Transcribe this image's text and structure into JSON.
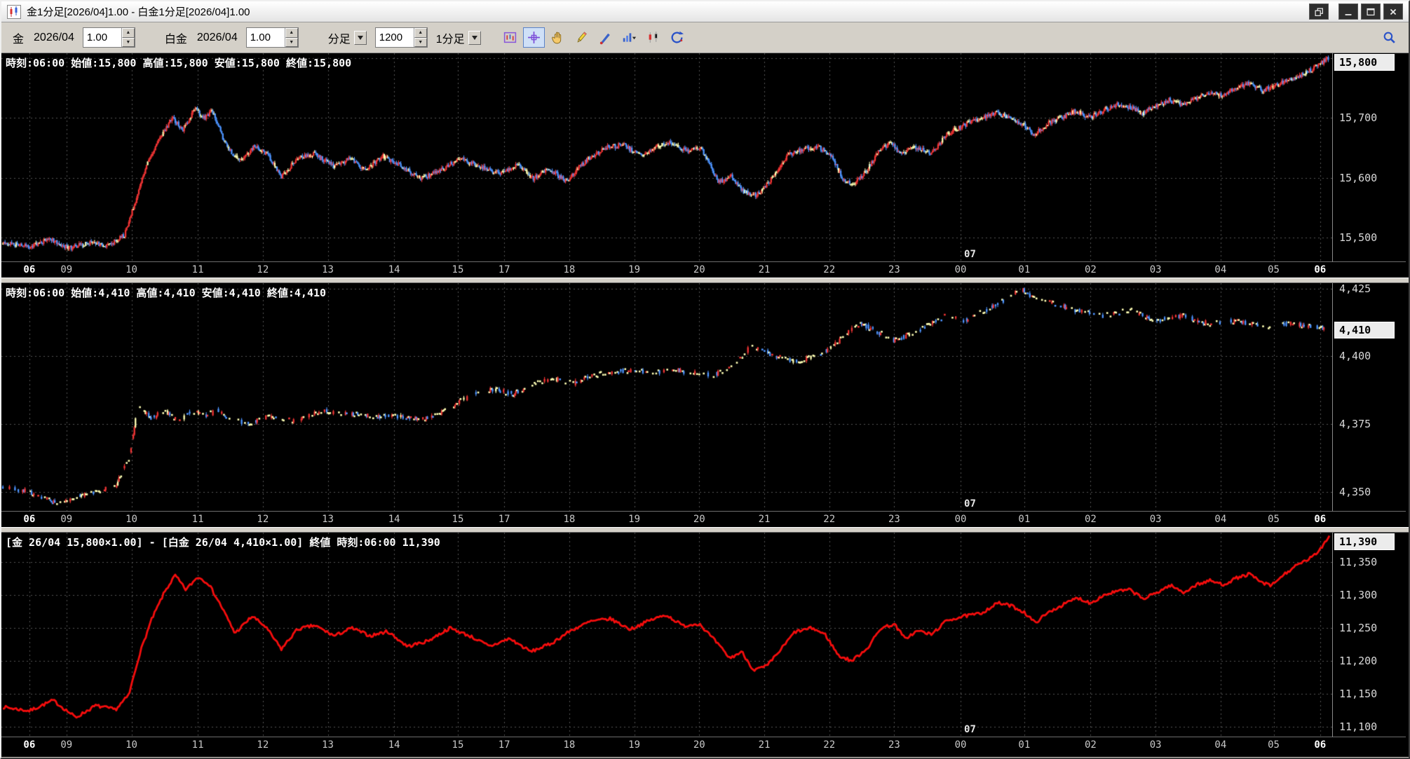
{
  "window": {
    "title": "金1分足[2026/04]1.00 - 白金1分足[2026/04]1.00"
  },
  "toolbar": {
    "gold_label": "金",
    "gold_month": "2026/04",
    "gold_ratio": "1.00",
    "platinum_label": "白金",
    "platinum_month": "2026/04",
    "platinum_ratio": "1.00",
    "period_label": "分足",
    "bar_count": "1200",
    "style_label": "1分足"
  },
  "colors": {
    "grid": "#565656",
    "up": "#f23535",
    "down": "#4d94ff",
    "doji": "#ffffb4",
    "spread_line": "#f50d0d",
    "axis_text": "#d0d0d0"
  },
  "xaxis": {
    "ticks": [
      {
        "frac": 0.02,
        "label": "06",
        "bold": true
      },
      {
        "frac": 0.048,
        "label": "09"
      },
      {
        "frac": 0.097,
        "label": "10"
      },
      {
        "frac": 0.147,
        "label": "11"
      },
      {
        "frac": 0.196,
        "label": "12"
      },
      {
        "frac": 0.245,
        "label": "13"
      },
      {
        "frac": 0.295,
        "label": "14"
      },
      {
        "frac": 0.343,
        "label": "15"
      },
      {
        "frac": 0.378,
        "label": "17"
      },
      {
        "frac": 0.427,
        "label": "18"
      },
      {
        "frac": 0.476,
        "label": "19"
      },
      {
        "frac": 0.525,
        "label": "20"
      },
      {
        "frac": 0.574,
        "label": "21"
      },
      {
        "frac": 0.623,
        "label": "22"
      },
      {
        "frac": 0.672,
        "label": "23"
      },
      {
        "frac": 0.722,
        "label": "00"
      },
      {
        "frac": 0.77,
        "label": "01"
      },
      {
        "frac": 0.82,
        "label": "02"
      },
      {
        "frac": 0.869,
        "label": "03"
      },
      {
        "frac": 0.918,
        "label": "04"
      },
      {
        "frac": 0.958,
        "label": "05"
      },
      {
        "frac": 0.993,
        "label": "06",
        "bold": true
      }
    ]
  },
  "chart_data": [
    {
      "type": "candlestick",
      "name": "gold-1min",
      "info": "時刻:06:00 始値:15,800 高値:15,800 安値:15,800 終値:15,800",
      "ylim": [
        15460,
        15808
      ],
      "yticks": [
        {
          "v": 15800,
          "label": "15,800"
        },
        {
          "v": 15700,
          "label": "15,700"
        },
        {
          "v": 15600,
          "label": "15,600"
        },
        {
          "v": 15500,
          "label": "15,500"
        }
      ],
      "last": {
        "v": 15800,
        "label": "15,800"
      },
      "date_label": "07",
      "date_frac": 0.722,
      "seed": 11,
      "candles": 1200,
      "noise": 4,
      "range": 4,
      "doji": 1.0,
      "density": 1,
      "anchors": [
        [
          0,
          15490
        ],
        [
          0.02,
          15485
        ],
        [
          0.035,
          15498
        ],
        [
          0.05,
          15482
        ],
        [
          0.065,
          15492
        ],
        [
          0.08,
          15486
        ],
        [
          0.092,
          15505
        ],
        [
          0.1,
          15560
        ],
        [
          0.108,
          15620
        ],
        [
          0.118,
          15665
        ],
        [
          0.128,
          15700
        ],
        [
          0.136,
          15680
        ],
        [
          0.145,
          15715
        ],
        [
          0.152,
          15700
        ],
        [
          0.158,
          15712
        ],
        [
          0.168,
          15655
        ],
        [
          0.178,
          15628
        ],
        [
          0.19,
          15652
        ],
        [
          0.2,
          15638
        ],
        [
          0.21,
          15600
        ],
        [
          0.222,
          15632
        ],
        [
          0.235,
          15640
        ],
        [
          0.25,
          15618
        ],
        [
          0.262,
          15632
        ],
        [
          0.274,
          15612
        ],
        [
          0.287,
          15636
        ],
        [
          0.3,
          15620
        ],
        [
          0.315,
          15598
        ],
        [
          0.33,
          15612
        ],
        [
          0.345,
          15632
        ],
        [
          0.36,
          15618
        ],
        [
          0.375,
          15608
        ],
        [
          0.39,
          15622
        ],
        [
          0.4,
          15598
        ],
        [
          0.412,
          15615
        ],
        [
          0.425,
          15594
        ],
        [
          0.44,
          15628
        ],
        [
          0.455,
          15650
        ],
        [
          0.468,
          15655
        ],
        [
          0.48,
          15638
        ],
        [
          0.492,
          15650
        ],
        [
          0.503,
          15660
        ],
        [
          0.515,
          15645
        ],
        [
          0.527,
          15648
        ],
        [
          0.54,
          15592
        ],
        [
          0.55,
          15602
        ],
        [
          0.558,
          15578
        ],
        [
          0.568,
          15570
        ],
        [
          0.58,
          15598
        ],
        [
          0.592,
          15638
        ],
        [
          0.605,
          15648
        ],
        [
          0.615,
          15652
        ],
        [
          0.625,
          15638
        ],
        [
          0.633,
          15600
        ],
        [
          0.642,
          15588
        ],
        [
          0.652,
          15612
        ],
        [
          0.662,
          15648
        ],
        [
          0.67,
          15658
        ],
        [
          0.678,
          15638
        ],
        [
          0.688,
          15652
        ],
        [
          0.7,
          15640
        ],
        [
          0.712,
          15672
        ],
        [
          0.725,
          15688
        ],
        [
          0.737,
          15698
        ],
        [
          0.75,
          15710
        ],
        [
          0.76,
          15698
        ],
        [
          0.77,
          15688
        ],
        [
          0.778,
          15672
        ],
        [
          0.79,
          15692
        ],
        [
          0.8,
          15702
        ],
        [
          0.81,
          15712
        ],
        [
          0.82,
          15700
        ],
        [
          0.83,
          15712
        ],
        [
          0.84,
          15722
        ],
        [
          0.85,
          15718
        ],
        [
          0.86,
          15708
        ],
        [
          0.87,
          15720
        ],
        [
          0.88,
          15730
        ],
        [
          0.89,
          15722
        ],
        [
          0.9,
          15732
        ],
        [
          0.91,
          15742
        ],
        [
          0.92,
          15738
        ],
        [
          0.93,
          15750
        ],
        [
          0.94,
          15758
        ],
        [
          0.95,
          15746
        ],
        [
          0.958,
          15752
        ],
        [
          0.967,
          15760
        ],
        [
          0.976,
          15768
        ],
        [
          0.985,
          15778
        ],
        [
          0.993,
          15788
        ],
        [
          1,
          15800
        ]
      ]
    },
    {
      "type": "candlestick",
      "name": "platinum-1min",
      "info": "時刻:06:00 始値:4,410 高値:4,410 安値:4,410 終値:4,410",
      "ylim": [
        4343,
        4427
      ],
      "yticks": [
        {
          "v": 4425,
          "label": "4,425"
        },
        {
          "v": 4400,
          "label": "4,400"
        },
        {
          "v": 4375,
          "label": "4,375"
        },
        {
          "v": 4350,
          "label": "4,350"
        }
      ],
      "last": {
        "v": 4410,
        "label": "4,410"
      },
      "date_label": "07",
      "date_frac": 0.722,
      "seed": 23,
      "candles": 1200,
      "noise": 0.9,
      "range": 0.8,
      "doji": 0.5,
      "density": 0.45,
      "anchors": [
        [
          0,
          4352
        ],
        [
          0.02,
          4350
        ],
        [
          0.04,
          4346
        ],
        [
          0.055,
          4348
        ],
        [
          0.07,
          4350
        ],
        [
          0.085,
          4352
        ],
        [
          0.095,
          4362
        ],
        [
          0.102,
          4382
        ],
        [
          0.112,
          4377
        ],
        [
          0.122,
          4380
        ],
        [
          0.132,
          4376
        ],
        [
          0.142,
          4380
        ],
        [
          0.152,
          4378
        ],
        [
          0.162,
          4380
        ],
        [
          0.172,
          4377
        ],
        [
          0.185,
          4375
        ],
        [
          0.2,
          4378
        ],
        [
          0.22,
          4376
        ],
        [
          0.24,
          4380
        ],
        [
          0.26,
          4379
        ],
        [
          0.28,
          4378
        ],
        [
          0.3,
          4378
        ],
        [
          0.32,
          4377
        ],
        [
          0.34,
          4382
        ],
        [
          0.355,
          4386
        ],
        [
          0.37,
          4388
        ],
        [
          0.385,
          4386
        ],
        [
          0.4,
          4390
        ],
        [
          0.415,
          4392
        ],
        [
          0.43,
          4390
        ],
        [
          0.445,
          4393
        ],
        [
          0.46,
          4394
        ],
        [
          0.475,
          4395
        ],
        [
          0.49,
          4394
        ],
        [
          0.505,
          4395
        ],
        [
          0.52,
          4394
        ],
        [
          0.535,
          4393
        ],
        [
          0.55,
          4396
        ],
        [
          0.565,
          4404
        ],
        [
          0.578,
          4401
        ],
        [
          0.59,
          4399
        ],
        [
          0.6,
          4398
        ],
        [
          0.612,
          4400
        ],
        [
          0.625,
          4403
        ],
        [
          0.638,
          4409
        ],
        [
          0.648,
          4412
        ],
        [
          0.66,
          4409
        ],
        [
          0.672,
          4406
        ],
        [
          0.685,
          4408
        ],
        [
          0.7,
          4412
        ],
        [
          0.712,
          4415
        ],
        [
          0.725,
          4413
        ],
        [
          0.737,
          4416
        ],
        [
          0.75,
          4419
        ],
        [
          0.762,
          4423
        ],
        [
          0.768,
          4425
        ],
        [
          0.775,
          4422
        ],
        [
          0.79,
          4420
        ],
        [
          0.81,
          4417
        ],
        [
          0.83,
          4415
        ],
        [
          0.85,
          4417
        ],
        [
          0.87,
          4413
        ],
        [
          0.89,
          4415
        ],
        [
          0.91,
          4412
        ],
        [
          0.93,
          4413
        ],
        [
          0.95,
          4411
        ],
        [
          0.97,
          4412
        ],
        [
          0.985,
          4411
        ],
        [
          1,
          4410
        ]
      ]
    },
    {
      "type": "line",
      "name": "gold-platinum-spread",
      "info": "[金 26/04 15,800×1.00] - [白金 26/04 4,410×1.00] 終値 時刻:06:00 11,390",
      "ylim": [
        11085,
        11395
      ],
      "yticks": [
        {
          "v": 11350,
          "label": "11,350"
        },
        {
          "v": 11300,
          "label": "11,300"
        },
        {
          "v": 11250,
          "label": "11,250"
        },
        {
          "v": 11200,
          "label": "11,200"
        },
        {
          "v": 11150,
          "label": "11,150"
        },
        {
          "v": 11100,
          "label": "11,100"
        }
      ],
      "last": {
        "v": 11390,
        "label": "11,390"
      },
      "date_label": "07",
      "date_frac": 0.722,
      "seed": 7,
      "points": 900,
      "noise": 2.5,
      "anchors": [
        [
          0,
          11130
        ],
        [
          0.02,
          11124
        ],
        [
          0.038,
          11140
        ],
        [
          0.055,
          11114
        ],
        [
          0.07,
          11132
        ],
        [
          0.085,
          11126
        ],
        [
          0.095,
          11148
        ],
        [
          0.103,
          11210
        ],
        [
          0.112,
          11262
        ],
        [
          0.122,
          11305
        ],
        [
          0.13,
          11330
        ],
        [
          0.138,
          11308
        ],
        [
          0.147,
          11328
        ],
        [
          0.155,
          11318
        ],
        [
          0.165,
          11282
        ],
        [
          0.175,
          11242
        ],
        [
          0.188,
          11268
        ],
        [
          0.198,
          11252
        ],
        [
          0.21,
          11218
        ],
        [
          0.222,
          11248
        ],
        [
          0.235,
          11254
        ],
        [
          0.25,
          11238
        ],
        [
          0.263,
          11250
        ],
        [
          0.277,
          11238
        ],
        [
          0.29,
          11245
        ],
        [
          0.305,
          11222
        ],
        [
          0.32,
          11230
        ],
        [
          0.337,
          11250
        ],
        [
          0.352,
          11238
        ],
        [
          0.367,
          11222
        ],
        [
          0.382,
          11234
        ],
        [
          0.398,
          11214
        ],
        [
          0.413,
          11226
        ],
        [
          0.428,
          11246
        ],
        [
          0.443,
          11260
        ],
        [
          0.458,
          11264
        ],
        [
          0.473,
          11248
        ],
        [
          0.488,
          11262
        ],
        [
          0.5,
          11270
        ],
        [
          0.513,
          11253
        ],
        [
          0.525,
          11257
        ],
        [
          0.538,
          11228
        ],
        [
          0.548,
          11204
        ],
        [
          0.557,
          11214
        ],
        [
          0.566,
          11186
        ],
        [
          0.576,
          11192
        ],
        [
          0.586,
          11216
        ],
        [
          0.597,
          11244
        ],
        [
          0.61,
          11250
        ],
        [
          0.62,
          11240
        ],
        [
          0.63,
          11208
        ],
        [
          0.64,
          11200
        ],
        [
          0.652,
          11220
        ],
        [
          0.662,
          11250
        ],
        [
          0.672,
          11256
        ],
        [
          0.68,
          11234
        ],
        [
          0.69,
          11246
        ],
        [
          0.7,
          11240
        ],
        [
          0.712,
          11262
        ],
        [
          0.725,
          11268
        ],
        [
          0.737,
          11272
        ],
        [
          0.75,
          11288
        ],
        [
          0.76,
          11284
        ],
        [
          0.77,
          11274
        ],
        [
          0.778,
          11258
        ],
        [
          0.79,
          11276
        ],
        [
          0.8,
          11286
        ],
        [
          0.81,
          11296
        ],
        [
          0.82,
          11288
        ],
        [
          0.83,
          11300
        ],
        [
          0.84,
          11306
        ],
        [
          0.85,
          11308
        ],
        [
          0.86,
          11294
        ],
        [
          0.87,
          11304
        ],
        [
          0.88,
          11315
        ],
        [
          0.89,
          11304
        ],
        [
          0.9,
          11316
        ],
        [
          0.91,
          11322
        ],
        [
          0.92,
          11316
        ],
        [
          0.93,
          11326
        ],
        [
          0.94,
          11332
        ],
        [
          0.948,
          11320
        ],
        [
          0.956,
          11314
        ],
        [
          0.965,
          11330
        ],
        [
          0.973,
          11342
        ],
        [
          0.982,
          11352
        ],
        [
          0.99,
          11362
        ],
        [
          1,
          11390
        ]
      ]
    }
  ]
}
